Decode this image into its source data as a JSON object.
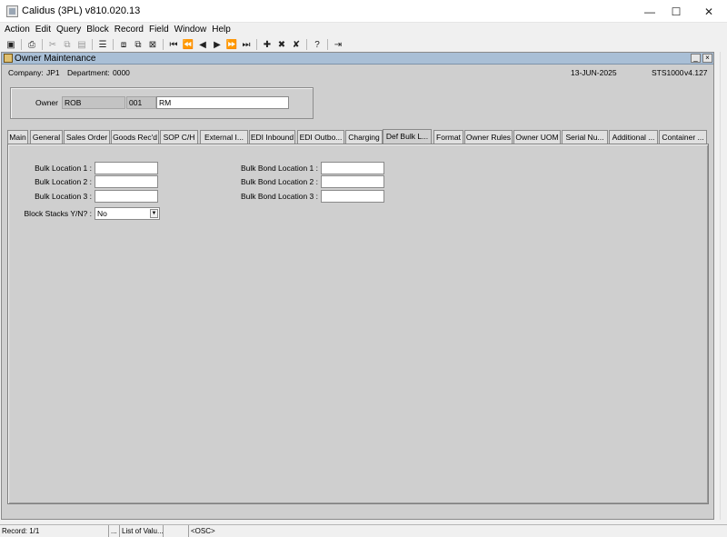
{
  "window": {
    "title": "Calidus (3PL) v810.020.13"
  },
  "menu": [
    "Action",
    "Edit",
    "Query",
    "Block",
    "Record",
    "Field",
    "Window",
    "Help"
  ],
  "toolbar": {
    "help_glyph": "?"
  },
  "form": {
    "title": "Owner Maintenance",
    "company_label": "Company:",
    "company": "JP1",
    "department_label": "Department:",
    "department": "0000",
    "date": "13-JUN-2025",
    "form_id": "STS1000",
    "version": "v4.127"
  },
  "owner": {
    "label": "Owner",
    "code": "ROB",
    "number": "001",
    "name": "RM"
  },
  "tabs": [
    "Main",
    "General",
    "Sales Order",
    "Goods Rec'd",
    "SOP C/H",
    "External I...",
    "EDI Inbound",
    "EDI Outbo...",
    "Charging",
    "Def Bulk L...",
    "Format",
    "Owner Rules",
    "Owner UOM",
    "Serial Nu...",
    "Additional ...",
    "Container ..."
  ],
  "active_tab": "Def Bulk L...",
  "bulk": {
    "loc1_label": "Bulk Location 1 :",
    "loc2_label": "Bulk Location 2 :",
    "loc3_label": "Bulk Location 3 :",
    "bond1_label": "Bulk Bond Location 1 :",
    "bond2_label": "Bulk Bond Location 2 :",
    "bond3_label": "Bulk Bond Location 3 :",
    "block_label": "Block Stacks Y/N? :",
    "block_value": "No"
  },
  "status": {
    "record": "Record: 1/1",
    "dots": "...",
    "lov": "List of Valu...",
    "osc": "<OSC>"
  }
}
